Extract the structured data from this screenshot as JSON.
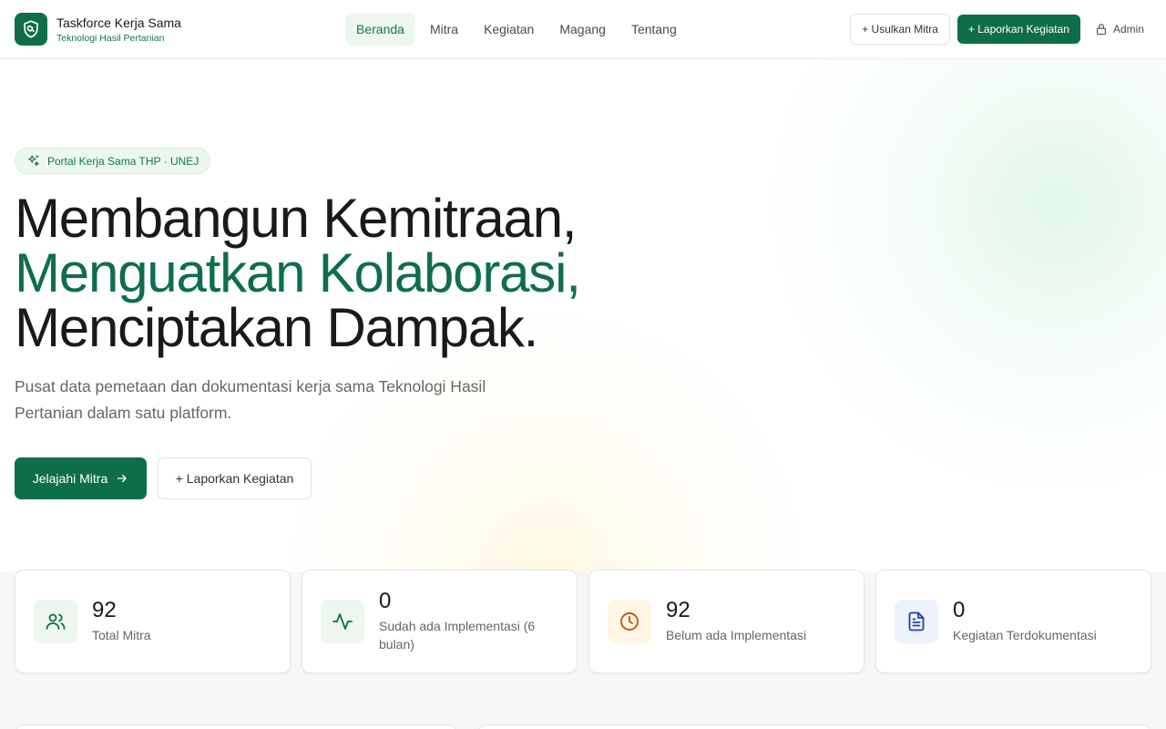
{
  "brand": {
    "title": "Taskforce Kerja Sama",
    "subtitle": "Teknologi Hasil Pertanian",
    "logo_icon": "handshake-shield-icon",
    "color": "#0f6e4a"
  },
  "nav": {
    "items": [
      {
        "label": "Beranda",
        "active": true
      },
      {
        "label": "Mitra",
        "active": false
      },
      {
        "label": "Kegiatan",
        "active": false
      },
      {
        "label": "Magang",
        "active": false
      },
      {
        "label": "Tentang",
        "active": false
      }
    ]
  },
  "header_actions": {
    "propose_partner": "+ Usulkan Mitra",
    "report_activity": "+ Laporkan Kegiatan",
    "admin": "Admin",
    "admin_icon": "lock-icon"
  },
  "hero": {
    "badge": "Portal Kerja Sama THP · UNEJ",
    "badge_icon": "sparkles-icon",
    "headline_line1": "Membangun Kemitraan,",
    "headline_line2": "Menguatkan Kolaborasi,",
    "headline_line3": "Menciptakan Dampak.",
    "lead": "Pusat data pemetaan dan dokumentasi kerja sama Teknologi Hasil Pertanian dalam satu platform.",
    "primary_button": "Jelajahi Mitra",
    "secondary_button": "+ Laporkan Kegiatan"
  },
  "stats": [
    {
      "value": "92",
      "label": "Total Mitra",
      "icon": "users-icon",
      "icon_color": "#0f6e4a",
      "icon_bg": "#edf7f0"
    },
    {
      "value": "0",
      "label": "Sudah ada Implementasi (6 bulan)",
      "icon": "activity-icon",
      "icon_color": "#0f6e4a",
      "icon_bg": "#edf7f0"
    },
    {
      "value": "92",
      "label": "Belum ada Implementasi",
      "icon": "clock-icon",
      "icon_color": "#c2570c",
      "icon_bg": "#fff6e6"
    },
    {
      "value": "0",
      "label": "Kegiatan Terdokumentasi",
      "icon": "document-icon",
      "icon_color": "#1e40af",
      "icon_bg": "#eef2fb"
    }
  ]
}
